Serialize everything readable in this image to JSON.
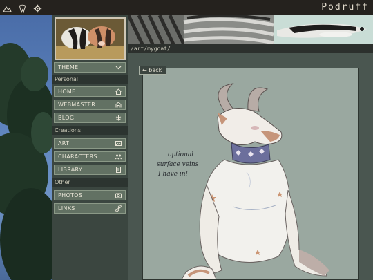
{
  "header": {
    "title": "Podruff",
    "icons": [
      "mountain-icon",
      "tooth-icon",
      "gear-icon"
    ]
  },
  "sidebar": {
    "theme_label": "THEME",
    "sections": {
      "personal": "Personal",
      "creations": "Creations",
      "other": "Other"
    },
    "items": [
      {
        "label": "HOME",
        "icon": "home-icon"
      },
      {
        "label": "WEBMASTER",
        "icon": "webmaster-icon"
      },
      {
        "label": "BLOG",
        "icon": "blog-icon"
      },
      {
        "label": "ART",
        "icon": "image-icon"
      },
      {
        "label": "CHARACTERS",
        "icon": "characters-icon"
      },
      {
        "label": "LIBRARY",
        "icon": "library-icon"
      },
      {
        "label": "PHOTOS",
        "icon": "camera-icon"
      },
      {
        "label": "LINKS",
        "icon": "link-icon"
      }
    ]
  },
  "main": {
    "path": "/art/mygoat/",
    "back_label": "← back",
    "artwork": {
      "note_lines": [
        "optional",
        "surface veins",
        "I have in!"
      ]
    }
  },
  "colors": {
    "topbar": "#25221e",
    "sidebar": "#3b4640",
    "menu_item": "#627163",
    "art_background": "#9aa8a0"
  }
}
